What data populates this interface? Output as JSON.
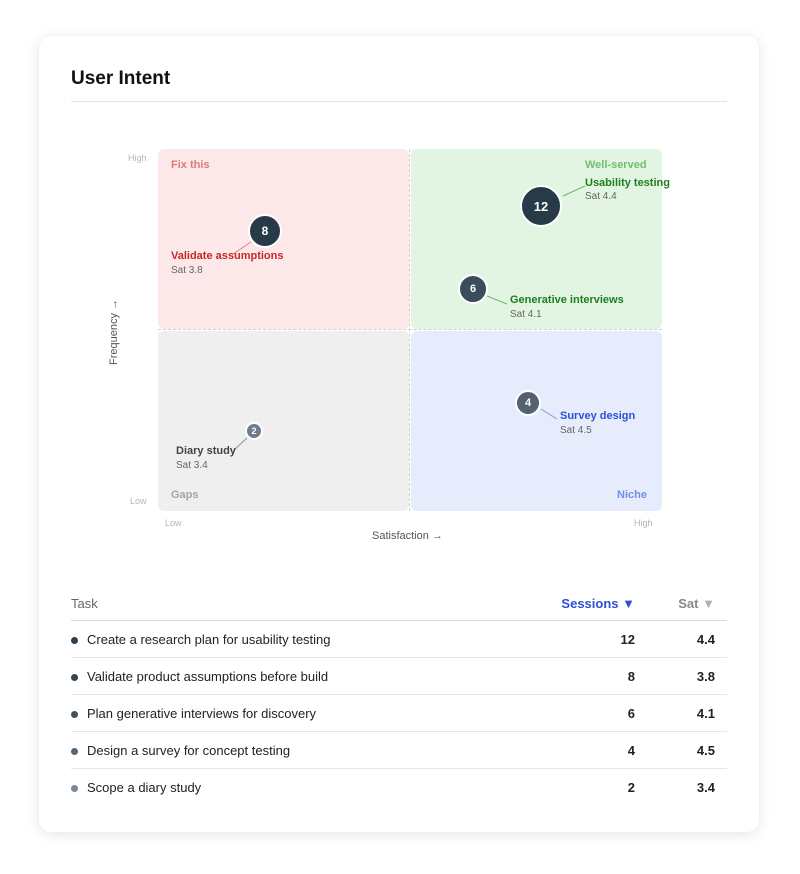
{
  "card": {
    "title": "User Intent"
  },
  "matrix": {
    "quadrants": {
      "top_left": "Fix this",
      "top_right": "Well-served",
      "bottom_left": "Gaps",
      "bottom_right": "Niche"
    },
    "y_axis": {
      "label": "Frequency →",
      "high": "High",
      "low": "Low"
    },
    "x_axis": {
      "label": "Satisfaction →",
      "low": "Low",
      "high": "High"
    },
    "points": [
      {
        "name": "Usability testing",
        "sessions": "12",
        "sat": "Sat 4.4",
        "label_color": "#1e7f1e"
      },
      {
        "name": "Validate assumptions",
        "sessions": "8",
        "sat": "Sat 3.8",
        "label_color": "#c62828"
      },
      {
        "name": "Generative interviews",
        "sessions": "6",
        "sat": "Sat 4.1",
        "label_color": "#1e7f1e"
      },
      {
        "name": "Survey design",
        "sessions": "4",
        "sat": "Sat 4.5",
        "label_color": "#2b50d6"
      },
      {
        "name": "Diary study",
        "sessions": "2",
        "sat": "Sat 3.4",
        "label_color": "#444444"
      }
    ]
  },
  "table": {
    "headers": {
      "task": "Task",
      "sessions": "Sessions ▼",
      "sat": "Sat",
      "sat_arrow": "▼"
    },
    "rows": [
      {
        "task": "Create a research plan for usability testing",
        "sessions": "12",
        "sat": "4.4",
        "dot_color": "#2c3e50"
      },
      {
        "task": "Validate product assumptions before build",
        "sessions": "8",
        "sat": "3.8",
        "dot_color": "#334455"
      },
      {
        "task": "Plan generative interviews for discovery",
        "sessions": "6",
        "sat": "4.1",
        "dot_color": "#3e4f5e"
      },
      {
        "task": "Design a survey for concept testing",
        "sessions": "4",
        "sat": "4.5",
        "dot_color": "#56667a"
      },
      {
        "task": "Scope a diary study",
        "sessions": "2",
        "sat": "3.4",
        "dot_color": "#7b8794"
      }
    ]
  },
  "colors": {
    "bubble_dark": "#263a48",
    "link_blue": "#2b50d6"
  }
}
